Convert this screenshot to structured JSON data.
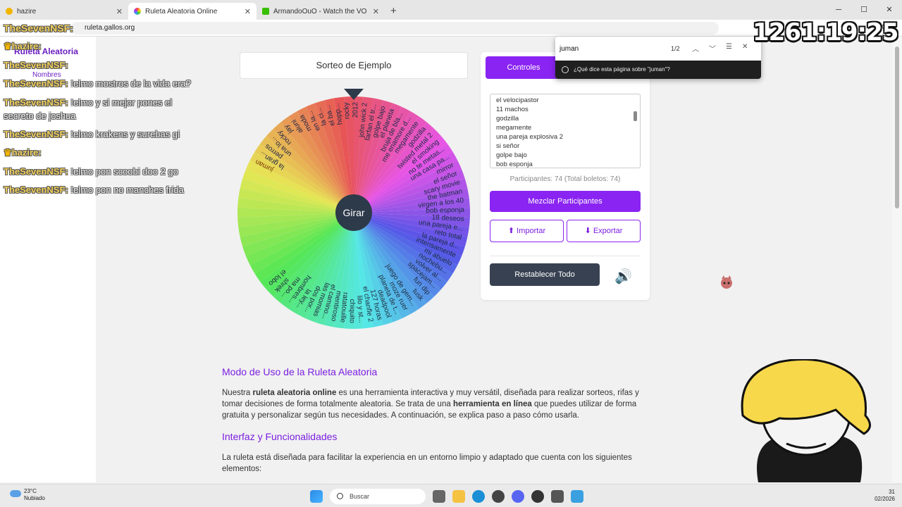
{
  "browser": {
    "tabs": [
      {
        "title": "hazire",
        "color": "#f2b600"
      },
      {
        "title": "Ruleta Aleatoria Online",
        "extra": "Person",
        "color": "#e8458b"
      },
      {
        "title": "ArmandoOuO - Watch the VO",
        "color": "#38c000"
      }
    ],
    "url": "ruleta.gallos.org",
    "chat_button": "Chat"
  },
  "find": {
    "query": "juman",
    "count": "1/2",
    "ask": "¿Qué dice esta página sobre \"juman\"?"
  },
  "page": {
    "raffle_title": "Sorteo de Ejemplo",
    "spin_label": "Girar",
    "controls_tab": "Controles",
    "participants": [
      "el velocipastor",
      "11 machos",
      "godzilla",
      "megamente",
      "una pareja explosiva 2",
      "si señor",
      "golpe bajo",
      "bob esponja"
    ],
    "count_text": "Participantes: 74 (Total boletos: 74)",
    "shuffle": "Mezclar Participantes",
    "import": "Importar",
    "export": "Exportar",
    "reset": "Restablecer Todo",
    "sound_icon": "volume-icon",
    "h_usage": "Modo de Uso de la Ruleta Aleatoria",
    "p_usage_1": "Nuestra ",
    "p_usage_b1": "ruleta aleatoria online",
    "p_usage_2": " es una herramienta interactiva y muy versátil, diseñada para realizar sorteos, rifas y tomar decisiones de forma totalmente aleatoria. Se trata de una ",
    "p_usage_b2": "herramienta en línea",
    "p_usage_3": " que puedes utilizar de forma gratuita y personalizar según tus necesidades. A continuación, se explica paso a paso cómo usarla.",
    "h_interface": "Interfaz y Funcionalidades",
    "p_interface": "La ruleta está diseñada para facilitar la experiencia en un entorno limpio y adaptado que cuenta con los siguientes elementos:"
  },
  "wheel_labels": [
    "juman",
    "la gran...",
    "perros",
    "una lo...",
    "rocky",
    "jay",
    "aluni",
    "moda",
    "en la...",
    "la ci...",
    "el ba...",
    "hopp...",
    "rocky",
    "2012",
    "john wick 2",
    "farfan el tr...",
    "golpe bajo",
    "el planeta",
    "bruja de bla...",
    "me enamore d...",
    "megamente",
    "godzilla",
    "twisted metal 2",
    "el smoking",
    "no te metas...",
    "una casa pa...",
    "mirror",
    "el señor",
    "scary movie",
    "the batman",
    "virgen a los 40",
    "bob esponja",
    "18 deseos",
    "una pareja e...",
    "reto total",
    "la pareja d...",
    "intensamente",
    "mi abuelo",
    "nochebu...",
    "volver al...",
    "spacejam...",
    "fun dip",
    "tusk",
    "juego de gem...",
    "moze ruer",
    "planeta de t...",
    "deadpool",
    "127 horas",
    "el chanfle 2",
    "lilo y st...",
    "chiquito",
    "ratatouille",
    "mentiroso",
    "el camino...",
    "las momias",
    "dos por...",
    "la ley...",
    "hombres...",
    "ma po...",
    "shrek",
    "el lobo"
  ],
  "chat": [
    {
      "user": "hazire:",
      "msg": "",
      "crown": true
    },
    {
      "user": "TheSevenNSF:",
      "msg": "",
      "crown": false
    },
    {
      "user": "TheSevenNSF:",
      "msg": "!elmo mostros de la vida era?",
      "crown": false
    },
    {
      "user": "TheSevenNSF:",
      "msg": "!elmo y si mejor pones el",
      "msg2": "secreto de joshua",
      "crown": false
    },
    {
      "user": "TheSevenNSF:",
      "msg": "!elmo krakens y surebas gi",
      "crown": false
    },
    {
      "user": "hazire:",
      "msg": "",
      "crown": true
    },
    {
      "user": "TheSevenNSF:",
      "msg": "!elmo pon scoobi doo 2 go",
      "crown": false
    },
    {
      "user": "TheSevenNSF:",
      "msg": "!elmo pon no manches frida",
      "crown": false
    }
  ],
  "chat_underlay": {
    "title": "Ruleta Aleatoria",
    "names": "Nombres"
  },
  "timer": "1261:19:25",
  "taskbar": {
    "temp": "23°C",
    "weather": "Nubiado",
    "search": "Buscar",
    "time": "31",
    "date": "02/2026"
  }
}
